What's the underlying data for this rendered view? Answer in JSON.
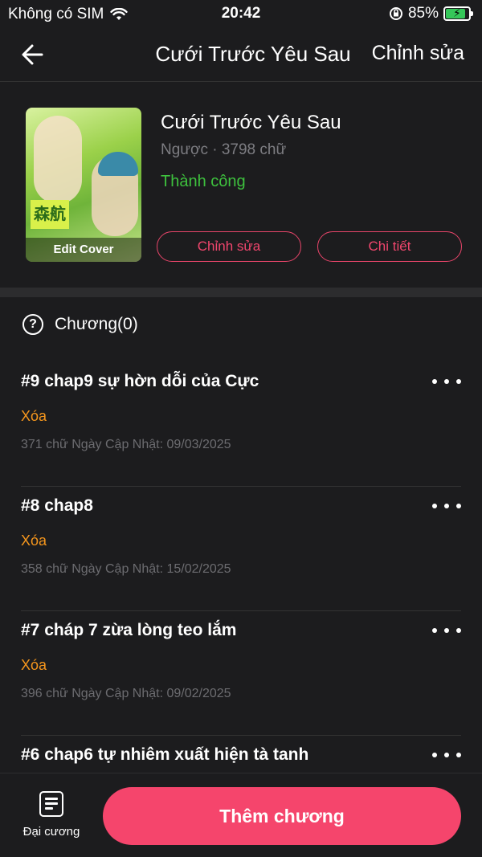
{
  "status_bar": {
    "carrier": "Không có SIM",
    "time": "20:42",
    "battery_percent": "85%",
    "battery_level": 0.85
  },
  "nav": {
    "title": "Cưới Trước Yêu Sau",
    "edit_label": "Chỉnh sửa"
  },
  "book": {
    "cover_label": "Edit Cover",
    "cover_tag": "森航",
    "title": "Cưới Trước Yêu Sau",
    "meta": "Ngược · 3798 chữ",
    "status": "Thành công",
    "edit_button": "Chỉnh sửa",
    "detail_button": "Chi tiết"
  },
  "chapters_header": {
    "help_glyph": "?",
    "label": "Chương(0)"
  },
  "chapters": [
    {
      "title": "#9 chap9 sự hờn dỗi của Cực",
      "delete": "Xóa",
      "info": "371 chữ Ngày Cập Nhật: 09/03/2025"
    },
    {
      "title": "#8 chap8",
      "delete": "Xóa",
      "info": "358 chữ Ngày Cập Nhật: 15/02/2025"
    },
    {
      "title": "#7 cháp 7 zừa lòng teo lắm",
      "delete": "Xóa",
      "info": "396 chữ Ngày Cập Nhật: 09/02/2025"
    },
    {
      "title": "#6 chap6 tự nhiêm xuất hiện tà tanh",
      "delete": "",
      "info": ""
    }
  ],
  "bottom": {
    "outline_label": "Đại cương",
    "add_chapter": "Thêm chương"
  },
  "colors": {
    "accent": "#f5456c",
    "success": "#3ec13e",
    "warning": "#f5961d",
    "background": "#1c1c1e"
  }
}
